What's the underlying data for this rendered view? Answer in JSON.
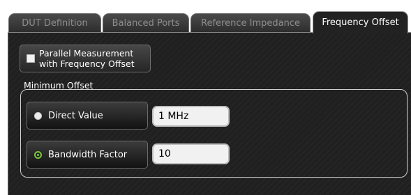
{
  "tabs": [
    {
      "label": "DUT Definition",
      "active": false
    },
    {
      "label": "Balanced Ports",
      "active": false
    },
    {
      "label": "Reference Impedance",
      "active": false
    },
    {
      "label": "Frequency Offset",
      "active": true
    }
  ],
  "parallel_measurement": {
    "label": "Parallel Measurement\nwith Frequency Offset",
    "checked": false
  },
  "minimum_offset": {
    "group_label": "Minimum Offset",
    "options": [
      {
        "label": "Direct Value",
        "selected": false,
        "value": "1 MHz"
      },
      {
        "label": "Bandwidth Factor",
        "selected": true,
        "value": "10"
      }
    ]
  },
  "colors": {
    "panel_background": "#202020",
    "selected_radio": "#78c83c",
    "field_background": "#f1f1f1"
  }
}
